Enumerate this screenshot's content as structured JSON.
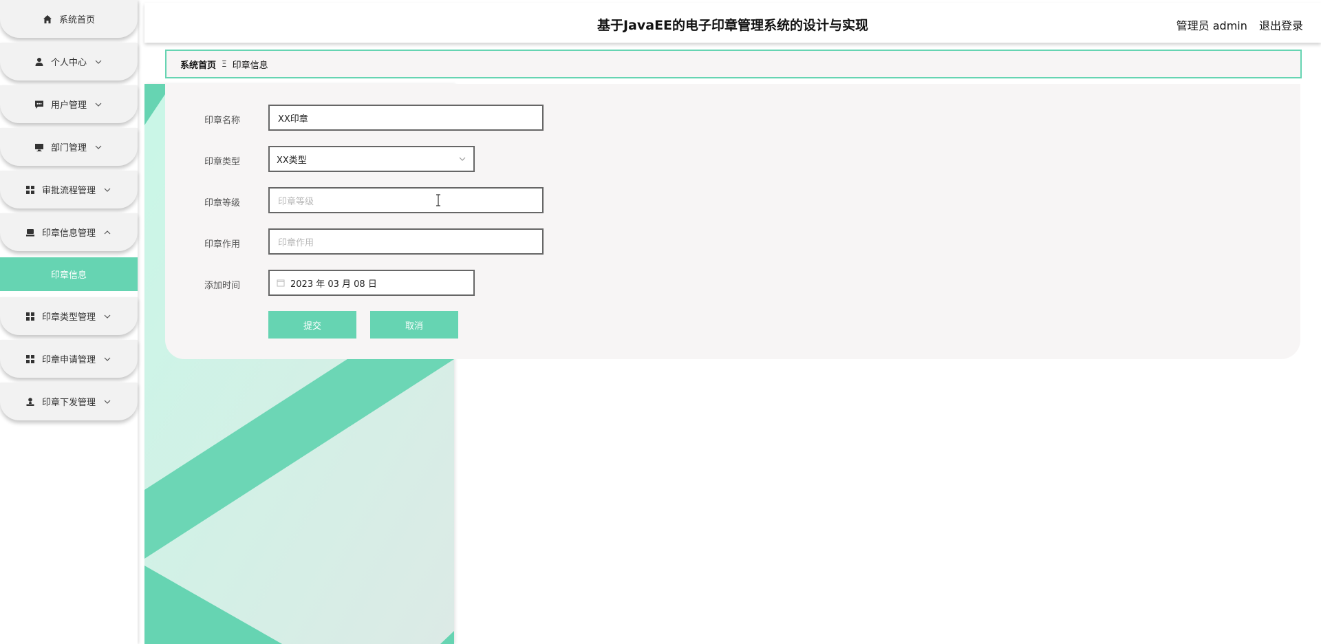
{
  "header": {
    "title": "基于JavaEE的电子印章管理系统的设计与实现",
    "user_label": "管理员 admin",
    "logout_label": "退出登录"
  },
  "sidebar": {
    "items": [
      {
        "label": "系统首页",
        "icon": "home-icon"
      },
      {
        "label": "个人中心",
        "icon": "user-icon"
      },
      {
        "label": "用户管理",
        "icon": "chat-icon"
      },
      {
        "label": "部门管理",
        "icon": "monitor-icon"
      },
      {
        "label": "审批流程管理",
        "icon": "grid-icon"
      },
      {
        "label": "印章信息管理",
        "icon": "stamp-icon"
      },
      {
        "label": "印章类型管理",
        "icon": "grid-icon"
      },
      {
        "label": "印章申请管理",
        "icon": "grid-icon"
      },
      {
        "label": "印章下发管理",
        "icon": "user-stamp-icon"
      }
    ],
    "active_sub": "印章信息"
  },
  "breadcrumb": {
    "home": "系统首页",
    "separator": "Ξ",
    "current": "印章信息"
  },
  "form": {
    "name": {
      "label": "印章名称",
      "value": "XX印章"
    },
    "type": {
      "label": "印章类型",
      "value": "XX类型"
    },
    "level": {
      "label": "印章等级",
      "placeholder": "印章等级"
    },
    "usage": {
      "label": "印章作用",
      "placeholder": "印章作用"
    },
    "time": {
      "label": "添加时间",
      "value": "2023 年 03 月 08 日"
    },
    "submit_label": "提交",
    "cancel_label": "取消"
  },
  "colors": {
    "accent": "#66d4b2",
    "card_bg": "#f7f5f5",
    "sidebar_item_bg": "#f2f2f2"
  }
}
